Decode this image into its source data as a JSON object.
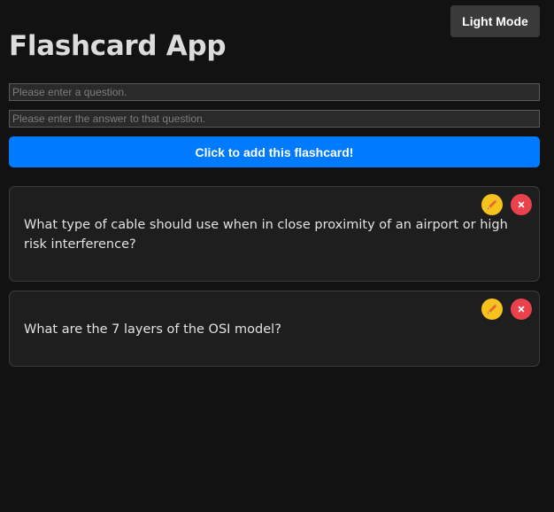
{
  "header": {
    "mode_toggle_label": "Light Mode",
    "title": "Flashcard App"
  },
  "form": {
    "question_placeholder": "Please enter a question.",
    "answer_placeholder": "Please enter the answer to that question.",
    "question_value": "",
    "answer_value": "",
    "add_button_label": "Click to add this flashcard!"
  },
  "flashcards": [
    {
      "question": "What type of cable should use when in close proximity of an airport or high risk interference?",
      "edit_icon": "pencil-icon",
      "delete_icon": "close-icon"
    },
    {
      "question": "What are the 7 layers of the OSI model?",
      "edit_icon": "pencil-icon",
      "delete_icon": "close-icon"
    }
  ],
  "colors": {
    "background": "#121212",
    "card_background": "#1e1e1e",
    "accent": "#007bff",
    "edit": "#f7c21b",
    "delete": "#e9424d",
    "toggle_background": "#3a3a3a"
  }
}
